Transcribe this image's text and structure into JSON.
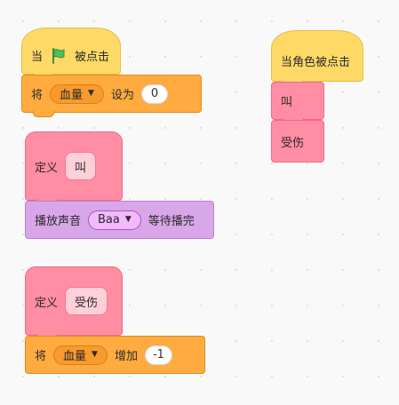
{
  "script1": {
    "hat": {
      "prefix": "当",
      "suffix": "被点击"
    },
    "set_block": {
      "prefix": "将",
      "variable": "血量",
      "action": "设为",
      "value": "0"
    }
  },
  "script2": {
    "define": {
      "label": "定义",
      "name": "叫"
    },
    "play_sound": {
      "prefix": "播放声音",
      "sound": "Baa",
      "suffix": "等待播完"
    }
  },
  "script3": {
    "define": {
      "label": "定义",
      "name": "受伤"
    },
    "change_block": {
      "prefix": "将",
      "variable": "血量",
      "action": "增加",
      "value": "-1"
    }
  },
  "script4": {
    "hat": {
      "label": "当角色被点击"
    },
    "call1": {
      "label": "叫"
    },
    "call2": {
      "label": "受伤"
    }
  },
  "icons": {
    "dropdown_caret": "caret-down-icon",
    "flag": "green-flag-icon"
  },
  "colors": {
    "events": "#ffd966",
    "data": "#ffab3f",
    "my_blocks": "#ff8da3",
    "sound": "#d9a6e9",
    "flag_green": "#4cbf56"
  }
}
